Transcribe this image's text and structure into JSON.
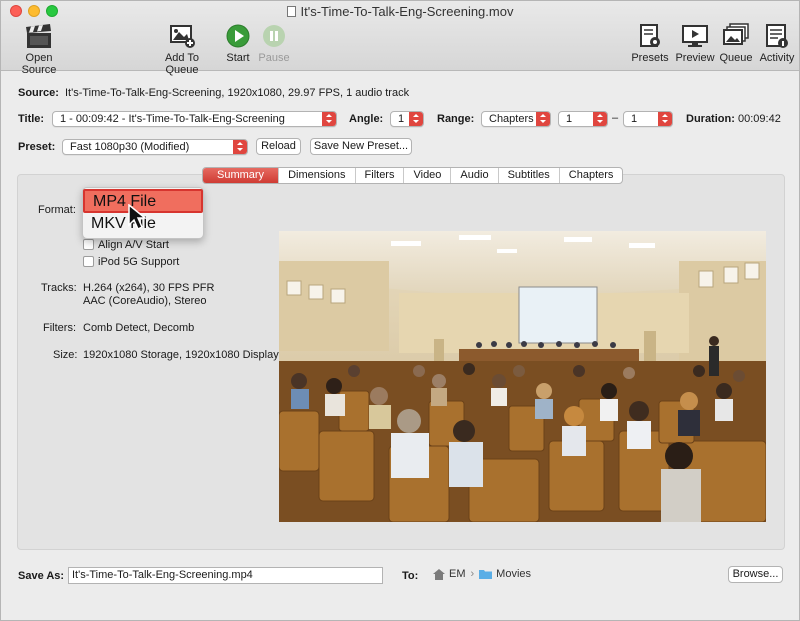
{
  "window": {
    "title": "It's-Time-To-Talk-Eng-Screening.mov"
  },
  "toolbar": {
    "open_source": "Open Source",
    "add_to_queue": "Add To Queue",
    "start": "Start",
    "pause": "Pause",
    "presets": "Presets",
    "preview": "Preview",
    "queue": "Queue",
    "activity": "Activity"
  },
  "source": {
    "label": "Source:",
    "value": "It's-Time-To-Talk-Eng-Screening, 1920x1080, 29.97 FPS, 1 audio track"
  },
  "title_row": {
    "label": "Title:",
    "value": "1 - 00:09:42 - It's-Time-To-Talk-Eng-Screening",
    "angle_label": "Angle:",
    "angle_value": "1",
    "range_label": "Range:",
    "range_value": "Chapters",
    "range_from": "1",
    "range_sep": "–",
    "range_to": "1",
    "duration_label": "Duration:",
    "duration_value": "00:09:42"
  },
  "preset_row": {
    "label": "Preset:",
    "value": "Fast 1080p30 (Modified)",
    "reload": "Reload",
    "save_new": "Save New Preset..."
  },
  "tabs": [
    "Summary",
    "Dimensions",
    "Filters",
    "Video",
    "Audio",
    "Subtitles",
    "Chapters"
  ],
  "summary": {
    "format_label": "Format:",
    "format_options": [
      "MP4 File",
      "MKV File"
    ],
    "align_av": "Align A/V Start",
    "ipod": "iPod 5G Support",
    "tracks_label": "Tracks:",
    "tracks_line1": "H.264 (x264), 30 FPS PFR",
    "tracks_line2": "AAC (CoreAudio), Stereo",
    "filters_label": "Filters:",
    "filters_value": "Comb Detect, Decomb",
    "size_label": "Size:",
    "size_value": "1920x1080 Storage, 1920x1080 Display"
  },
  "save": {
    "label": "Save As:",
    "value": "It's-Time-To-Talk-Eng-Screening.mp4",
    "to_label": "To:",
    "path_home": "EM",
    "path_sep": "›",
    "path_folder": "Movies",
    "browse": "Browse..."
  },
  "colors": {
    "accent": "#e0463f",
    "start_green": "#3a9c3a"
  }
}
